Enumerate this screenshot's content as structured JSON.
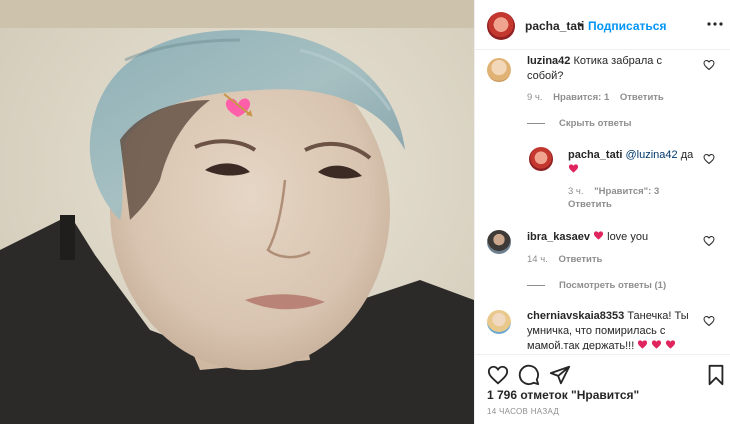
{
  "post": {
    "author": "pacha_tati",
    "dot": "•",
    "follow_label": "Подписаться",
    "likes_text": "1 796 отметок \"Нравится\"",
    "time_text": "14 ЧАСОВ НАЗАД"
  },
  "comments": [
    {
      "user": "luzina42",
      "text": "Котика забрала с собой?",
      "time": "9 ч.",
      "likes": "Нравится: 1",
      "reply": "Ответить",
      "toggle": "Скрыть ответы"
    },
    {
      "user": "pacha_tati",
      "mention": "@luzina42",
      "text": "да",
      "time": "3 ч.",
      "likes": "\"Нравится\": 3",
      "reply": "Ответить"
    },
    {
      "user": "ibra_kasaev",
      "text": "love you",
      "time": "14 ч.",
      "reply": "Ответить",
      "toggle": "Посмотреть ответы (1)"
    },
    {
      "user": "cherniavskaia8353",
      "text": "Танечка! Ты умничка, что помирилась с мамой.так держать!!!"
    }
  ],
  "icons": {
    "more": "more-horizontal-icon",
    "like": "heart-outline-icon",
    "comment": "comment-icon",
    "share": "paper-plane-icon",
    "save": "bookmark-icon",
    "emoji": "heart-with-arrow-emoji"
  },
  "colors": {
    "accent": "#0095f6",
    "heart": "#ed4956",
    "muted": "#8e8e8e"
  }
}
